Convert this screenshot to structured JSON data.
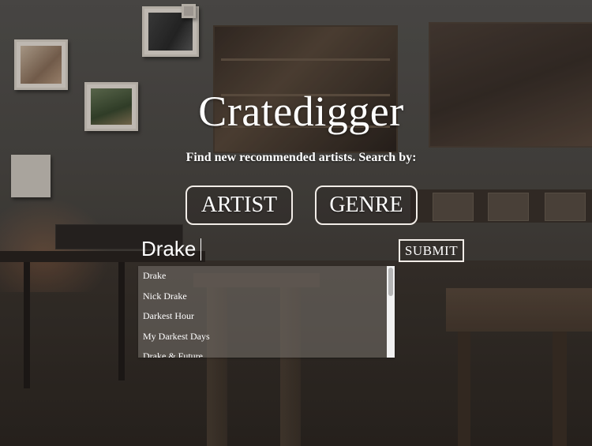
{
  "app": {
    "title": "Cratedigger",
    "subtitle": "Find new recommended artists. Search by:"
  },
  "search_modes": {
    "artist_label": "ARTIST",
    "genre_label": "GENRE"
  },
  "search": {
    "value": "Drake",
    "submit_label": "SUBMIT"
  },
  "suggestions": [
    {
      "label": "Drake"
    },
    {
      "label": "Nick Drake"
    },
    {
      "label": "Darkest Hour"
    },
    {
      "label": "My Darkest Days"
    },
    {
      "label": "Drake & Future"
    }
  ],
  "colors": {
    "text": "#ffffff",
    "button_border": "#f2ede8",
    "dropdown_bg": "#78736e"
  }
}
